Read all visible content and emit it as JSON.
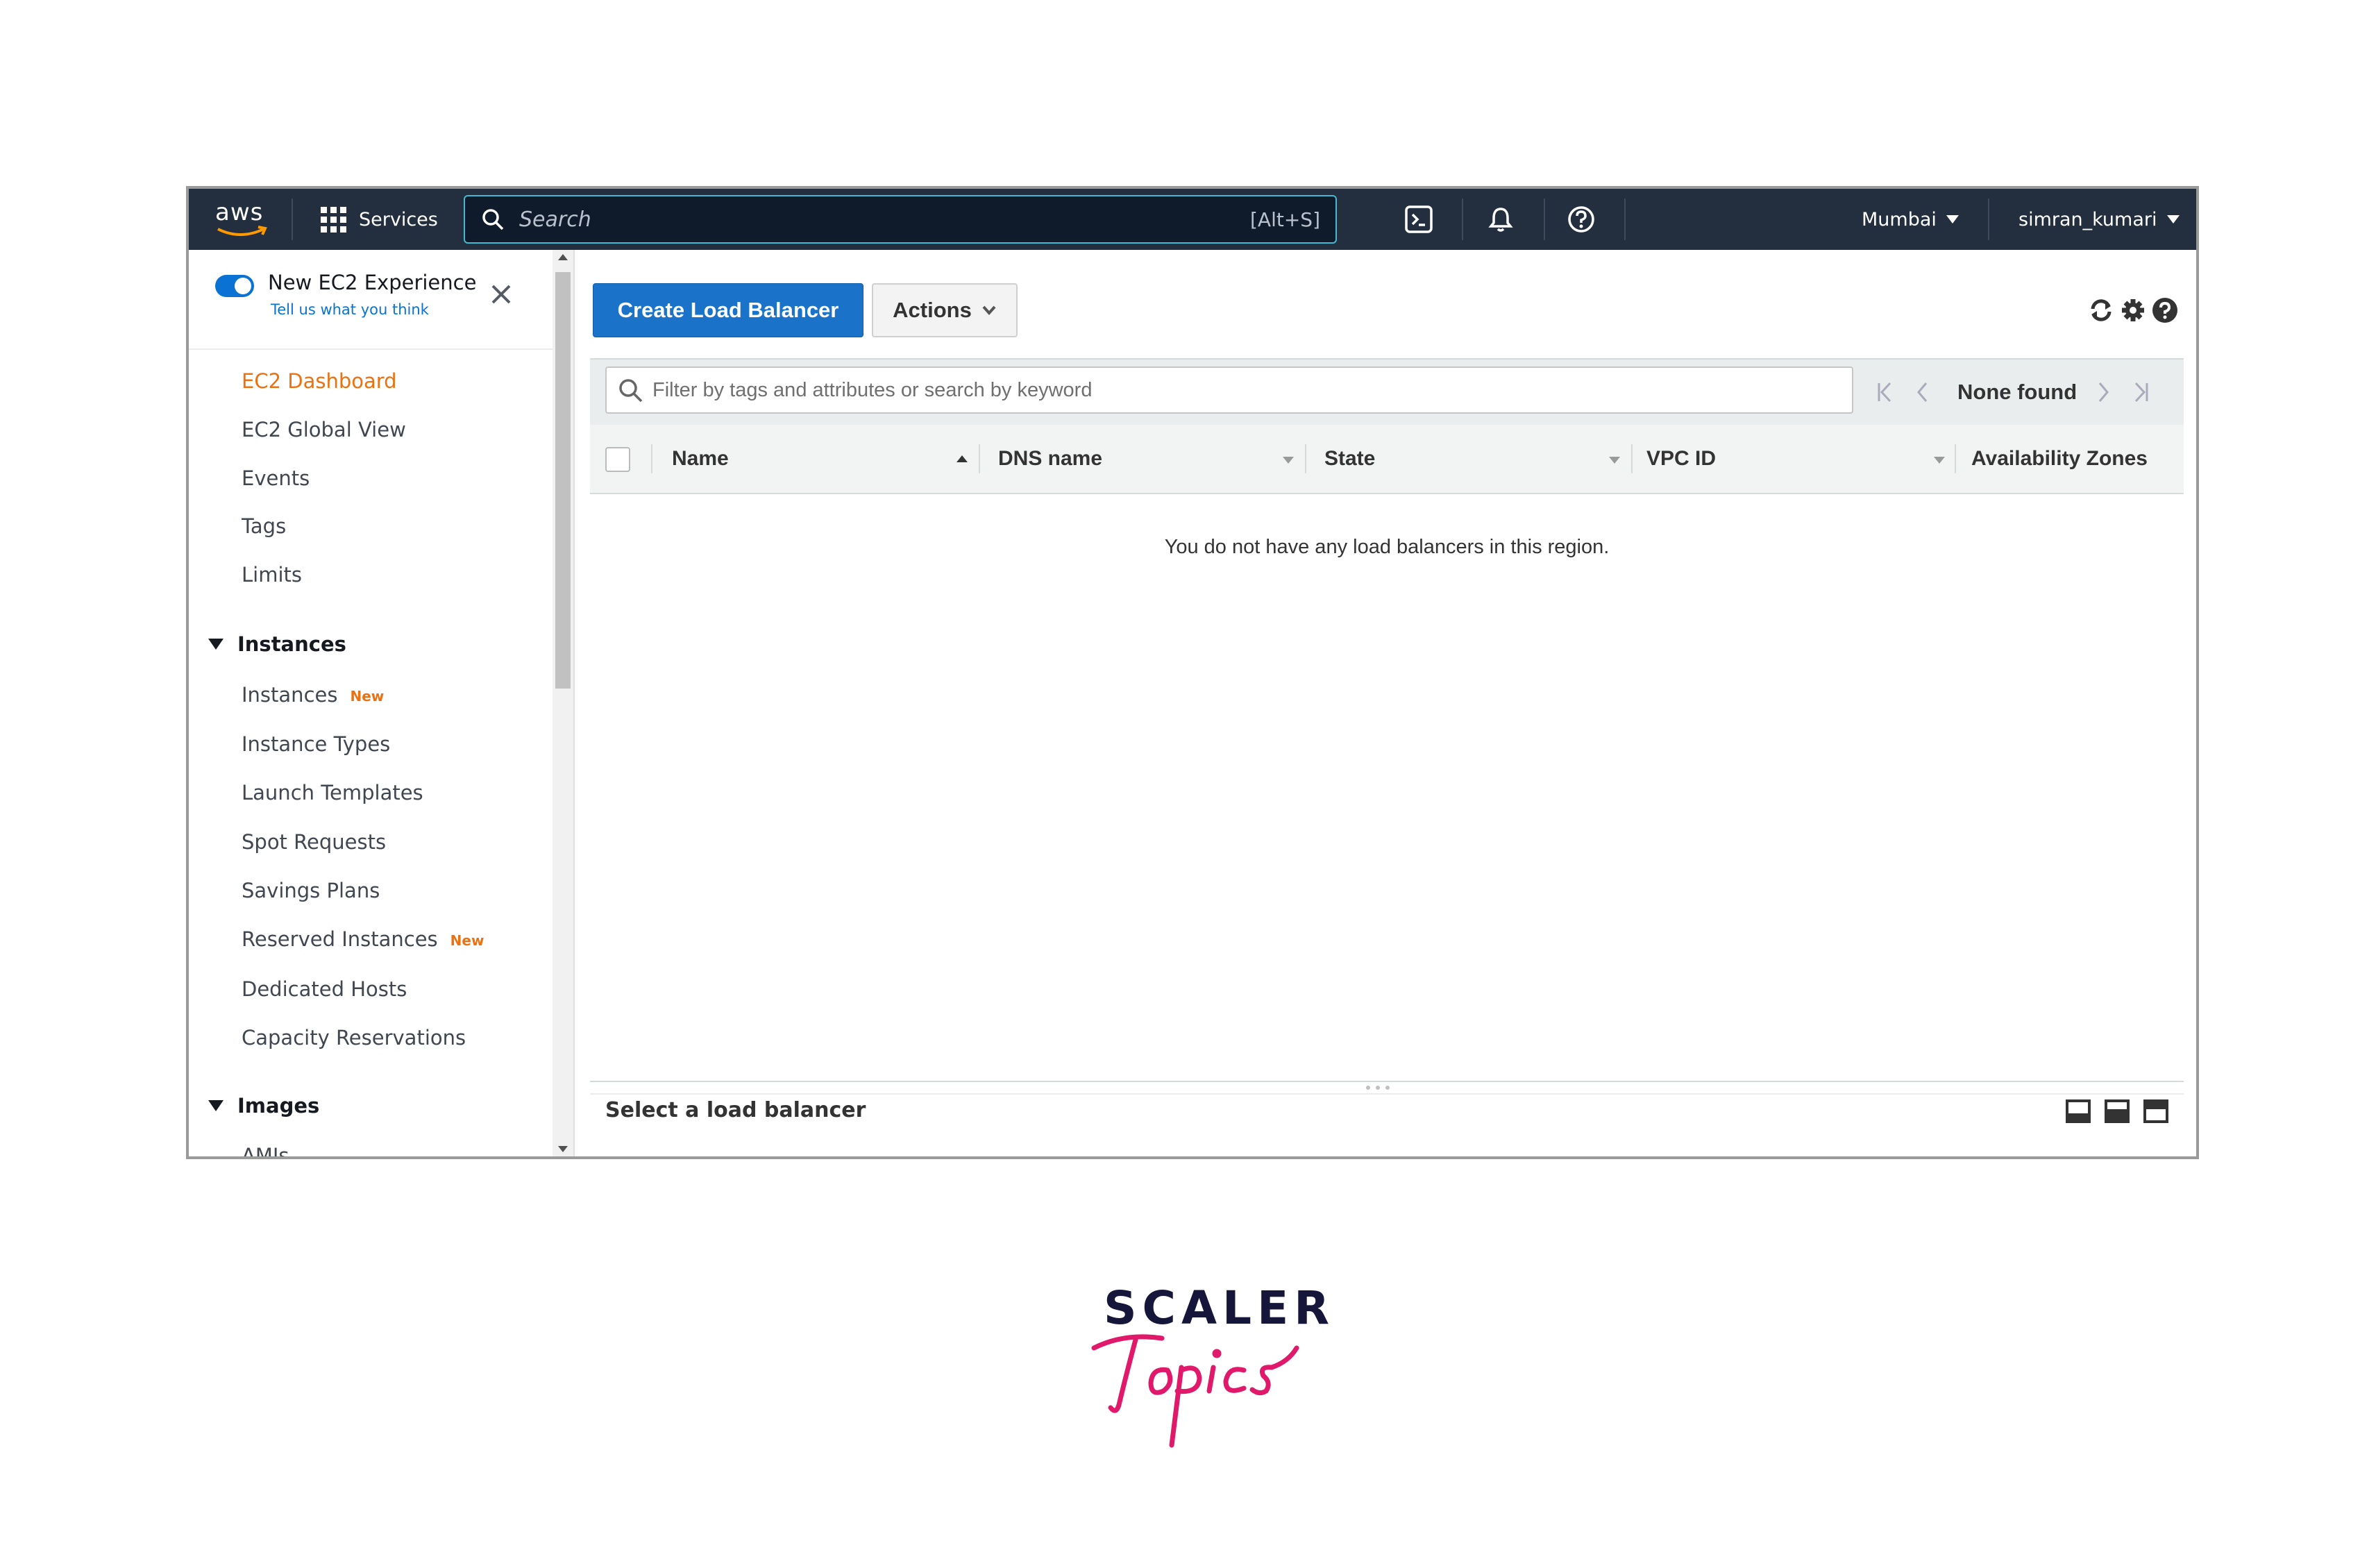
{
  "topnav": {
    "logo_text": "aws",
    "services_label": "Services",
    "search_placeholder": "Search",
    "search_shortcut": "[Alt+S]",
    "region": "Mumbai",
    "user": "simran_kumari",
    "icons": [
      "grid-icon",
      "search-icon",
      "cloudshell-icon",
      "bell-icon",
      "help-icon"
    ]
  },
  "sidebar": {
    "experience_label": "New EC2 Experience",
    "experience_sub": "Tell us what you think",
    "top_items": [
      {
        "label": "EC2 Dashboard",
        "active": true
      },
      {
        "label": "EC2 Global View"
      },
      {
        "label": "Events"
      },
      {
        "label": "Tags"
      },
      {
        "label": "Limits"
      }
    ],
    "sections": [
      {
        "title": "Instances",
        "items": [
          {
            "label": "Instances",
            "badge": "New"
          },
          {
            "label": "Instance Types"
          },
          {
            "label": "Launch Templates"
          },
          {
            "label": "Spot Requests"
          },
          {
            "label": "Savings Plans"
          },
          {
            "label": "Reserved Instances",
            "badge": "New"
          },
          {
            "label": "Dedicated Hosts"
          },
          {
            "label": "Capacity Reservations"
          }
        ]
      },
      {
        "title": "Images",
        "items": [
          {
            "label": "AMIs"
          }
        ]
      }
    ]
  },
  "main": {
    "create_button": "Create Load Balancer",
    "actions_button": "Actions",
    "filter_placeholder": "Filter by tags and attributes or search by keyword",
    "pagination_text": "None found",
    "columns": [
      "Name",
      "DNS name",
      "State",
      "VPC ID",
      "Availability Zones"
    ],
    "empty_message": "You do not have any load balancers in this region.",
    "detail_title": "Select a load balancer"
  },
  "brand": {
    "line1": "SCALER",
    "line2": "Topics"
  },
  "colors": {
    "nav_bg": "#232f3e",
    "search_border": "#44b9d6",
    "active_orange": "#ec7211",
    "primary_blue": "#1a73c8",
    "toggle_blue": "#0972d3",
    "brand_pink": "#e0196a",
    "brand_navy": "#15163a"
  }
}
